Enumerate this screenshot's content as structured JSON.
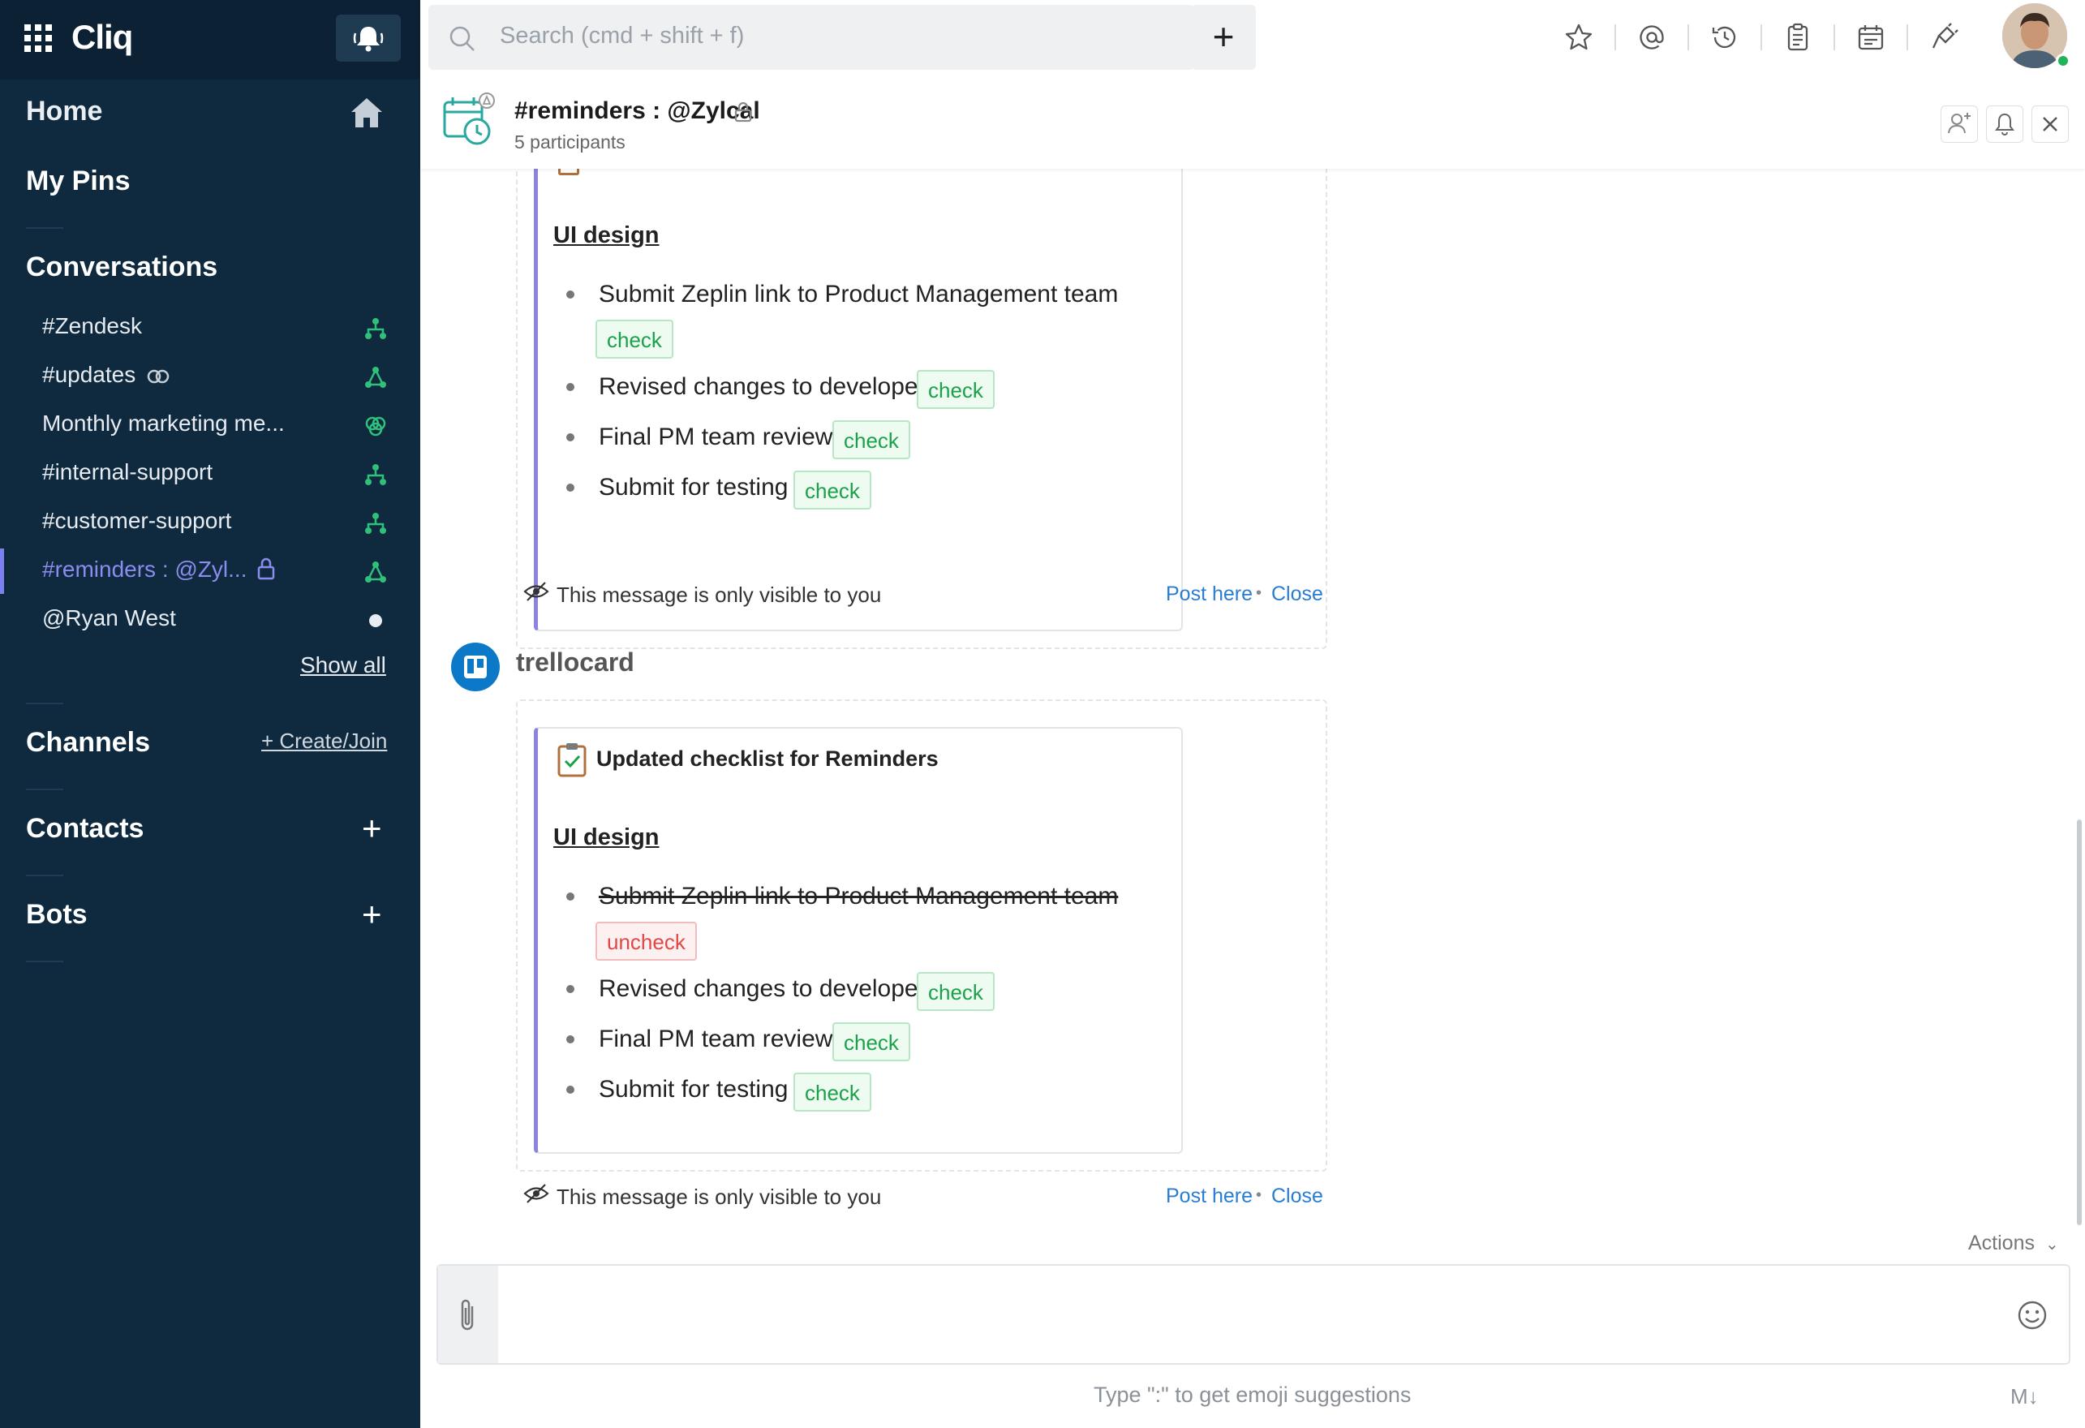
{
  "app": {
    "name": "Cliq"
  },
  "sidebar": {
    "home": "Home",
    "pins": "My Pins",
    "conversations_heading": "Conversations",
    "conversations": [
      {
        "label": "#Zendesk"
      },
      {
        "label": "#updates"
      },
      {
        "label": "Monthly marketing me..."
      },
      {
        "label": "#internal-support"
      },
      {
        "label": "#customer-support"
      },
      {
        "label": "#reminders : @Zyl..."
      },
      {
        "label": "@Ryan West"
      }
    ],
    "show_all": "Show all",
    "channels": "Channels",
    "create_join": "+ Create/Join",
    "contacts": "Contacts",
    "bots": "Bots",
    "accent_color": "#7b7ff0"
  },
  "topbar": {
    "search_placeholder": "Search (cmd + shift + f)",
    "new_label": "+"
  },
  "chat": {
    "title": "#reminders : @Zylcal",
    "participants": "5 participants"
  },
  "messages": [
    {
      "section": "UI design",
      "items": [
        {
          "text": "Submit Zeplin link to Product Management team",
          "tag": "check"
        },
        {
          "text": "Revised changes to developer",
          "tag": "check"
        },
        {
          "text": "Final PM team review",
          "tag": "check"
        },
        {
          "text": "Submit for testing",
          "tag": "check"
        }
      ],
      "visibility_note": "This message is only visible to you",
      "post_here": "Post here",
      "close": "Close"
    },
    {
      "sender": "trellocard",
      "card_title": "Updated checklist for Reminders",
      "section": "UI design",
      "items": [
        {
          "text": "Submit Zeplin link to Product Management team",
          "tag": "uncheck"
        },
        {
          "text": "Revised changes to developer",
          "tag": "check"
        },
        {
          "text": "Final PM team review",
          "tag": "check"
        },
        {
          "text": "Submit for testing",
          "tag": "check"
        }
      ],
      "visibility_note": "This message is only visible to you",
      "post_here": "Post here",
      "close": "Close"
    }
  ],
  "composer": {
    "actions_label": "Actions",
    "hint": "Type \":\" to get emoji suggestions",
    "markdown_label": "M↓"
  }
}
